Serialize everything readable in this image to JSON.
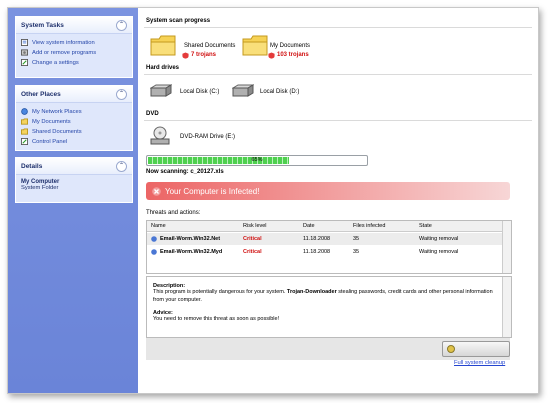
{
  "sidebar": {
    "system_tasks": {
      "title": "System Tasks",
      "items": [
        {
          "label": "View system information",
          "icon": "info-icon"
        },
        {
          "label": "Add or remove programs",
          "icon": "programs-icon"
        },
        {
          "label": "Change a settings",
          "icon": "settings-icon"
        }
      ]
    },
    "other_places": {
      "title": "Other Places",
      "items": [
        {
          "label": "My Network Places",
          "icon": "network-icon"
        },
        {
          "label": "My Documents",
          "icon": "documents-icon"
        },
        {
          "label": "Shared Documents",
          "icon": "folder-icon"
        },
        {
          "label": "Control Panel",
          "icon": "control-panel-icon"
        }
      ]
    },
    "details": {
      "title": "Details",
      "name": "My Computer",
      "type": "System Folder"
    }
  },
  "scan": {
    "title": "System scan progress",
    "folders": [
      {
        "label": "Shared Documents",
        "trojans": "7 trojans"
      },
      {
        "label": "My Documents",
        "trojans": "103 trojans"
      }
    ],
    "hard_drives_title": "Hard drives",
    "drives": [
      "Local Disk (C:)",
      "Local Disk (D:)"
    ],
    "dvd_title": "DVD",
    "dvd_drive": "DVD-RAM Drive (E:)",
    "progress_percent": 65,
    "progress_label": "65%",
    "now_scanning": "Now scanning: c_20127.xls"
  },
  "alert": {
    "title": "Your Computer is Infected!",
    "color": "#e85a5a"
  },
  "threats": {
    "title": "Threats and actions:",
    "columns": [
      "Name",
      "Risk level",
      "Date",
      "Files infected",
      "State"
    ],
    "rows": [
      {
        "name": "Email-Worm.Win32.Net",
        "risk": "Critical",
        "date": "11.18.2008",
        "files": "35",
        "state": "Waiting removal"
      },
      {
        "name": "Email-Worm.Win32.Myd",
        "risk": "Critical",
        "date": "11.18.2008",
        "files": "35",
        "state": "Waiting removal"
      }
    ]
  },
  "description": {
    "title": "Description:",
    "text_1": "This program is potentially dangerous for your system.",
    "text_bold": "Trojan-Downloader",
    "text_2": "stealing passwords, credit cards and other personal information from your computer.",
    "advice_title": "Advice:",
    "advice_text": "You need to remove this threat as soon as possible!"
  },
  "cleanup": {
    "link": "Full system cleanup"
  }
}
